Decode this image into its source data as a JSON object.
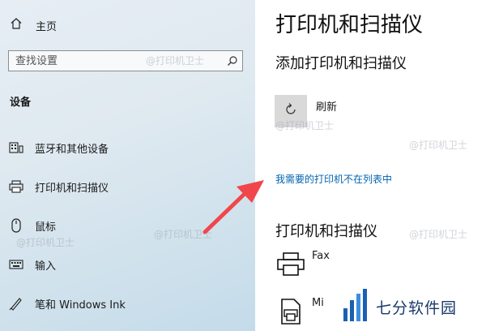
{
  "sidebar": {
    "home_label": "主页",
    "search_placeholder": "查找设置",
    "section_label": "设备",
    "items": [
      {
        "label": "蓝牙和其他设备",
        "icon": "keyboard-bluetooth-icon"
      },
      {
        "label": "打印机和扫描仪",
        "icon": "printer-icon"
      },
      {
        "label": "鼠标",
        "icon": "mouse-icon"
      },
      {
        "label": "输入",
        "icon": "keyboard-icon"
      },
      {
        "label": "笔和 Windows Ink",
        "icon": "pen-icon"
      }
    ]
  },
  "main": {
    "page_title": "打印机和扫描仪",
    "add_section_title": "添加打印机和扫描仪",
    "refresh_label": "刷新",
    "missing_printer_link": "我需要的打印机不在列表中",
    "printers_section_title": "打印机和扫描仪",
    "devices": [
      {
        "name": "Fax",
        "icon": "fax-icon"
      },
      {
        "name": "Mi",
        "icon": "document-printer-icon"
      }
    ]
  },
  "watermark": "@打印机卫士",
  "logo": {
    "text": "七分软件园"
  },
  "colors": {
    "link": "#0063b1",
    "arrow": "#f0474a",
    "accent_logo": "#1a5fb4"
  }
}
